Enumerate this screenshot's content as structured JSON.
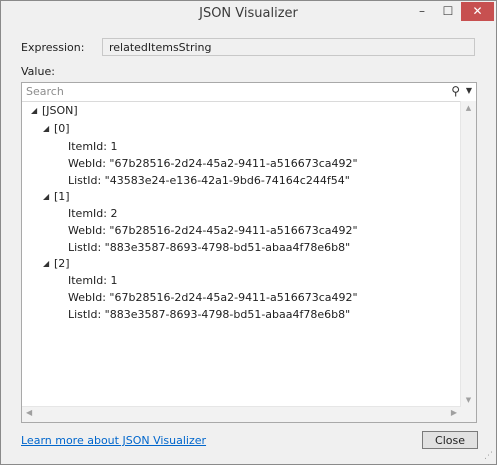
{
  "window": {
    "title": "JSON Visualizer",
    "minimize": "–",
    "maximize": "☐",
    "close": "✕"
  },
  "expression": {
    "label": "Expression:",
    "value": "relatedItemsString"
  },
  "value": {
    "label": "Value:",
    "search_placeholder": "Search"
  },
  "tree": {
    "root": "[JSON]",
    "items": [
      {
        "index": "[0]",
        "lines": [
          "ItemId: 1",
          "WebId: \"67b28516-2d24-45a2-9411-a516673ca492\"",
          "ListId: \"43583e24-e136-42a1-9bd6-74164c244f54\""
        ]
      },
      {
        "index": "[1]",
        "lines": [
          "ItemId: 2",
          "WebId: \"67b28516-2d24-45a2-9411-a516673ca492\"",
          "ListId: \"883e3587-8693-4798-bd51-abaa4f78e6b8\""
        ]
      },
      {
        "index": "[2]",
        "lines": [
          "ItemId: 1",
          "WebId: \"67b28516-2d24-45a2-9411-a516673ca492\"",
          "ListId: \"883e3587-8693-4798-bd51-abaa4f78e6b8\""
        ]
      }
    ]
  },
  "footer": {
    "link": "Learn more about JSON Visualizer",
    "close_label": "Close"
  }
}
